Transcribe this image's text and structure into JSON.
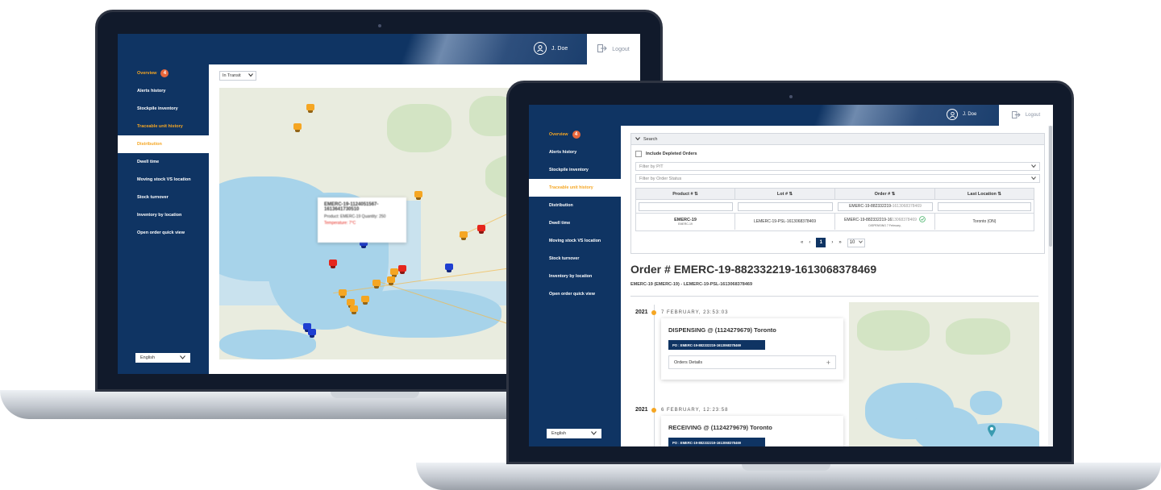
{
  "user": {
    "name": "J. Doe",
    "logout_label": "Logout"
  },
  "sidebar": {
    "items": [
      {
        "label": "Overview",
        "badge": "4"
      },
      {
        "label": "Alerts history"
      },
      {
        "label": "Stockpile inventory"
      },
      {
        "label": "Traceable unit history"
      },
      {
        "label": "Distribution"
      },
      {
        "label": "Dwell time"
      },
      {
        "label": "Moving stock VS location"
      },
      {
        "label": "Stock turnover"
      },
      {
        "label": "Inventory by location"
      },
      {
        "label": "Open order quick view"
      }
    ],
    "language": "English"
  },
  "left_screen": {
    "filter_value": "In Transit",
    "popup": {
      "title_line1": "EMERC-19-1124051567-",
      "title_line2": "1613641730510",
      "line2": "Product: EMERC-19    Quantity: 250",
      "line3": "Temperature: 7°C"
    }
  },
  "right_screen": {
    "search_label": "Search",
    "include_depleted_label": "Include Depleted Orders",
    "filter_pt_placeholder": "Filter by P/T",
    "filter_status_placeholder": "Filter by Order Status",
    "table": {
      "headers": [
        "Product #",
        "Lot #",
        "Order #",
        "Last Location"
      ],
      "order_filter_value_a": "EMERC-19-882332219-",
      "order_filter_value_b": "1613068378469",
      "row": {
        "product": "EMERC-19",
        "product_sub": "EMERC-19",
        "lot": "LEMERC-19-PSL-1613068378469",
        "order_a": "EMERC-19-882332219-16",
        "order_b": "13068378469",
        "order_sub": "DISPENSING 7 February,",
        "location": "Toronto (ON)"
      }
    },
    "pagination": {
      "first": "«",
      "prev": "‹",
      "page": "1",
      "next": "›",
      "last": "»",
      "page_size": "10"
    },
    "order_title": "Order # EMERC-19-882332219-1613068378469",
    "order_subtitle": "EMERC-19 (EMERC-19) - LEMERC-19-PSL-1613068378469",
    "timeline": [
      {
        "year": "2021",
        "date": "7 FEBRUARY, 23:53:03",
        "title": "DISPENSING @ (1124279679) Toronto",
        "po": "PO : EMERC-19-882332219-1613068378469",
        "details_label": "Orders Details"
      },
      {
        "year": "2021",
        "date": "6 FEBRUARY, 12:23:58",
        "title": "RECEIVING @ (1124279679) Toronto",
        "po": "PO : EMERC-19-882332219-1613068378469"
      }
    ]
  },
  "colors": {
    "navy": "#0f3463",
    "orange": "#f5a623",
    "badge": "#e8663a",
    "marker_orange": "#f5a623",
    "marker_red": "#e5261d",
    "marker_blue": "#1f3fd1",
    "map_water": "#c9e2ee"
  }
}
